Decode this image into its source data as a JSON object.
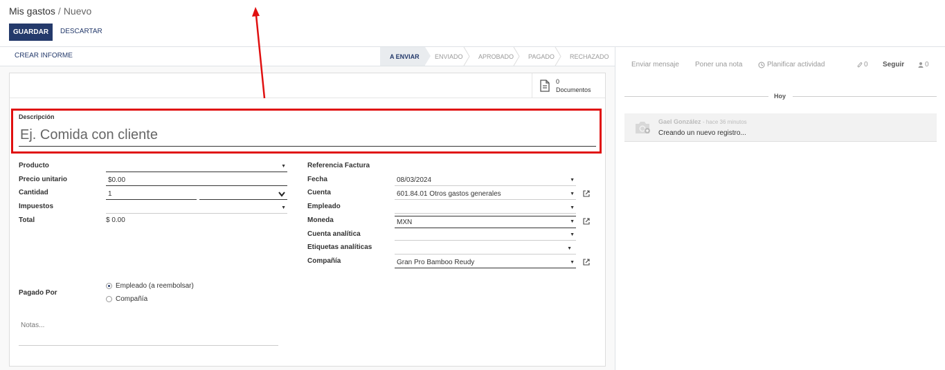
{
  "breadcrumb": {
    "parent": "Mis gastos",
    "separator": "/",
    "current": "Nuevo"
  },
  "toolbar": {
    "save_label": "GUARDAR",
    "discard_label": "DESCARTAR"
  },
  "statusbar": {
    "report_button": "CREAR INFORME",
    "stages": [
      "A ENVIAR",
      "ENVIADO",
      "APROBADO",
      "PAGADO",
      "RECHAZADO"
    ],
    "active_stage": "A ENVIAR"
  },
  "documents": {
    "count": "0",
    "label": "Documentos",
    "icon": "document-icon"
  },
  "description": {
    "label": "Descripción",
    "placeholder": "Ej. Comida con cliente"
  },
  "left_fields": {
    "producto_label": "Producto",
    "precio_label": "Precio unitario",
    "precio_value": "$0.00",
    "cantidad_label": "Cantidad",
    "cantidad_value": "1",
    "impuestos_label": "Impuestos",
    "total_label": "Total",
    "total_value": "$ 0.00"
  },
  "right_fields": {
    "referencia_label": "Referencia Factura",
    "fecha_label": "Fecha",
    "fecha_value": "08/03/2024",
    "cuenta_label": "Cuenta",
    "cuenta_value": "601.84.01 Otros gastos generales",
    "empleado_label": "Empleado",
    "moneda_label": "Moneda",
    "moneda_value": "MXN",
    "cuenta_analitica_label": "Cuenta analítica",
    "etiquetas_label": "Etiquetas analíticas",
    "compania_label": "Compañía",
    "compania_value": "Gran Pro Bamboo Reudy"
  },
  "paid_by": {
    "label": "Pagado Por",
    "options": [
      "Empleado (a reembolsar)",
      "Compañía"
    ],
    "selected": "Empleado (a reembolsar)"
  },
  "notes": {
    "placeholder": "Notas..."
  },
  "chatter": {
    "send_message": "Enviar mensaje",
    "log_note": "Poner una nota",
    "schedule_activity": "Planificar actividad",
    "attachments_count": "0",
    "follow": "Seguir",
    "followers_count": "0",
    "date_separator": "Hoy",
    "message": {
      "author": "Gael González",
      "time": "- hace 36 minutos",
      "body": "Creando un nuevo registro..."
    }
  },
  "colors": {
    "primary": "#243a6b",
    "highlight_border": "#e01010",
    "annotation_arrow": "#e01010"
  }
}
